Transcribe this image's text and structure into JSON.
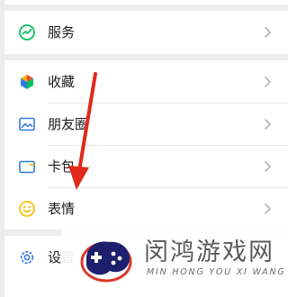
{
  "menu": {
    "group1": [
      {
        "label": "服务",
        "icon": "services-icon"
      }
    ],
    "group2": [
      {
        "label": "收藏",
        "icon": "favorites-cube-icon"
      },
      {
        "label": "朋友圈",
        "icon": "moments-image-icon"
      },
      {
        "label": "卡包",
        "icon": "card-wallet-icon"
      },
      {
        "label": "表情",
        "icon": "sticker-smiley-icon"
      }
    ],
    "group3": [
      {
        "label": "设置",
        "icon": "settings-gear-icon"
      }
    ]
  },
  "watermark": {
    "title": "闵鸿游戏网",
    "subtitle": "MIN HONG YOU XI WANG"
  },
  "colors": {
    "background": "#ededed",
    "row": "#ffffff",
    "arrow": "#e02a1a",
    "services_icon": "#07c160",
    "moments_icon": "#2d7de0",
    "card_icon": "#2d7de0",
    "sticker_icon": "#f7c000",
    "settings_icon": "#2d7de0",
    "logo_dark": "#1c1f6e",
    "logo_accent": "#d83a2c"
  }
}
